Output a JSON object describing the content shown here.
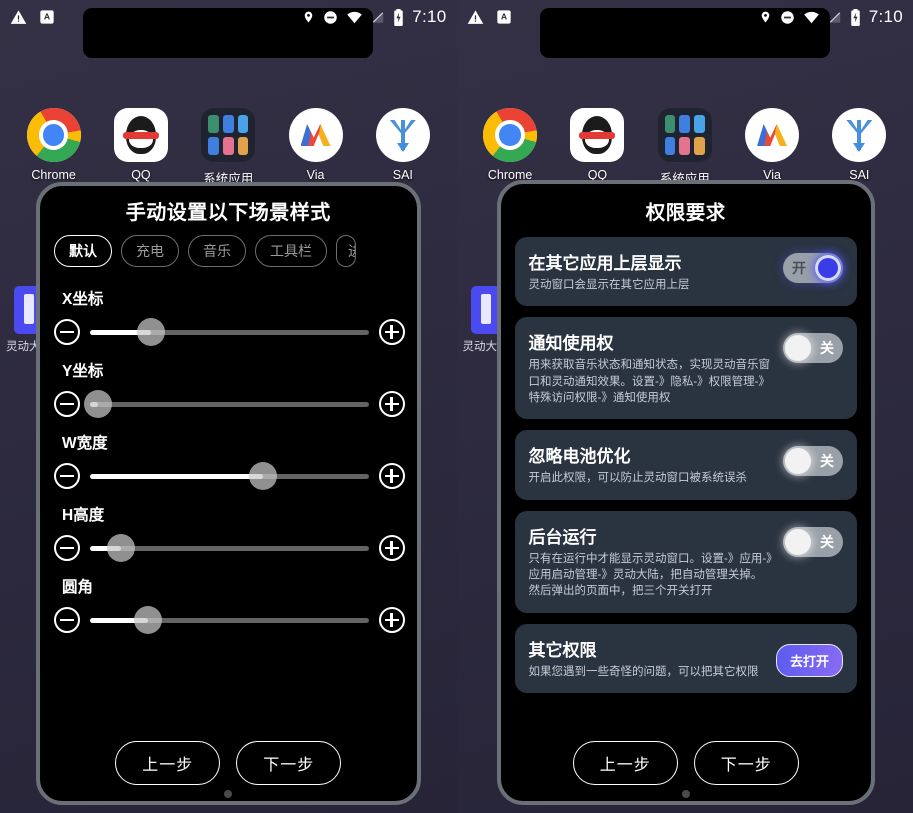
{
  "statusbar": {
    "time": "7:10",
    "left_icons": [
      "warning-triangle-icon",
      "a-badge-icon"
    ],
    "right_icons": [
      "location-pin-icon",
      "do-not-disturb-icon",
      "wifi-icon",
      "signal-off-icon",
      "battery-charging-icon"
    ]
  },
  "home": {
    "apps": [
      {
        "label": "Chrome",
        "icon": "chrome-icon"
      },
      {
        "label": "QQ",
        "icon": "qq-icon"
      },
      {
        "label": "系统应用",
        "icon": "system-apps-folder-icon"
      },
      {
        "label": "Via",
        "icon": "via-icon"
      },
      {
        "label": "SAI",
        "icon": "sai-icon"
      }
    ],
    "side_widget_label": "灵动大陆"
  },
  "left_dialog": {
    "title": "手动设置以下场景样式",
    "tabs": [
      {
        "label": "默认",
        "active": true
      },
      {
        "label": "充电",
        "active": false
      },
      {
        "label": "音乐",
        "active": false
      },
      {
        "label": "工具栏",
        "active": false
      },
      {
        "label": "进",
        "active": false
      }
    ],
    "sliders": [
      {
        "label": "X坐标",
        "value": 22,
        "minus_icon": "minus-circle-icon",
        "plus_icon": "plus-circle-icon"
      },
      {
        "label": "Y坐标",
        "value": 3,
        "minus_icon": "minus-circle-icon",
        "plus_icon": "plus-circle-icon"
      },
      {
        "label": "W宽度",
        "value": 62,
        "minus_icon": "minus-circle-icon",
        "plus_icon": "plus-circle-icon"
      },
      {
        "label": "H高度",
        "value": 11,
        "minus_icon": "minus-circle-icon",
        "plus_icon": "plus-circle-icon"
      },
      {
        "label": "圆角",
        "value": 21,
        "minus_icon": "minus-circle-icon",
        "plus_icon": "plus-circle-icon"
      }
    ],
    "footer": {
      "prev": "上一步",
      "next": "下一步"
    }
  },
  "right_dialog": {
    "title": "权限要求",
    "permissions": [
      {
        "title": "在其它应用上层显示",
        "desc": "灵动窗口会显示在其它应用上层",
        "control": "toggle",
        "state": "on",
        "state_label": "开"
      },
      {
        "title": "通知使用权",
        "desc": "用来获取音乐状态和通知状态，实现灵动音乐窗口和灵动通知效果。设置-》隐私-》权限管理-》特殊访问权限-》通知使用权",
        "control": "toggle",
        "state": "off",
        "state_label": "关"
      },
      {
        "title": "忽略电池优化",
        "desc": "开启此权限，可以防止灵动窗口被系统误杀",
        "control": "toggle",
        "state": "off",
        "state_label": "关"
      },
      {
        "title": "后台运行",
        "desc": "只有在运行中才能显示灵动窗口。设置-》应用-》应用启动管理-》灵动大陆，把自动管理关掉。然后弹出的页面中，把三个开关打开",
        "control": "toggle",
        "state": "off",
        "state_label": "关"
      },
      {
        "title": "其它权限",
        "desc": "如果您遇到一些奇怪的问题，可以把其它权限",
        "control": "button",
        "button_label": "去打开"
      }
    ],
    "footer": {
      "prev": "上一步",
      "next": "下一步"
    }
  },
  "colors": {
    "accent_blue": "#3a3ce6",
    "card_bg": "#2a3340",
    "wallpaper": "#2e2b40",
    "toggle_track": "#9aa0a8"
  }
}
